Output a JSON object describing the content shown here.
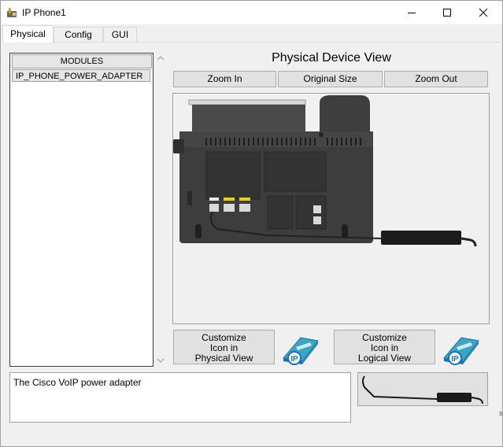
{
  "window": {
    "title": "IP Phone1",
    "minimize_icon": "minimize-icon",
    "maximize_icon": "maximize-icon",
    "close_icon": "close-icon"
  },
  "tabs": [
    {
      "label": "Physical",
      "active": true
    },
    {
      "label": "Config",
      "active": false
    },
    {
      "label": "GUI",
      "active": false
    }
  ],
  "modules": {
    "header": "MODULES",
    "items": [
      "IP_PHONE_POWER_ADAPTER"
    ]
  },
  "physical_view": {
    "title": "Physical Device View",
    "zoom_in": "Zoom In",
    "original_size": "Original Size",
    "zoom_out": "Zoom Out"
  },
  "customize": {
    "physical": {
      "line1": "Customize",
      "line2": "Icon in",
      "line3": "Physical View"
    },
    "logical": {
      "line1": "Customize",
      "line2": "Icon in",
      "line3": "Logical View"
    },
    "icon_label": "IP"
  },
  "description": "The Cisco VoIP power adapter",
  "colors": {
    "window_bg": "#f0f0f0",
    "phone_body": "#3d3d3d",
    "icon_teal": "#3aa6c4",
    "icon_blue": "#1e6fb0"
  }
}
